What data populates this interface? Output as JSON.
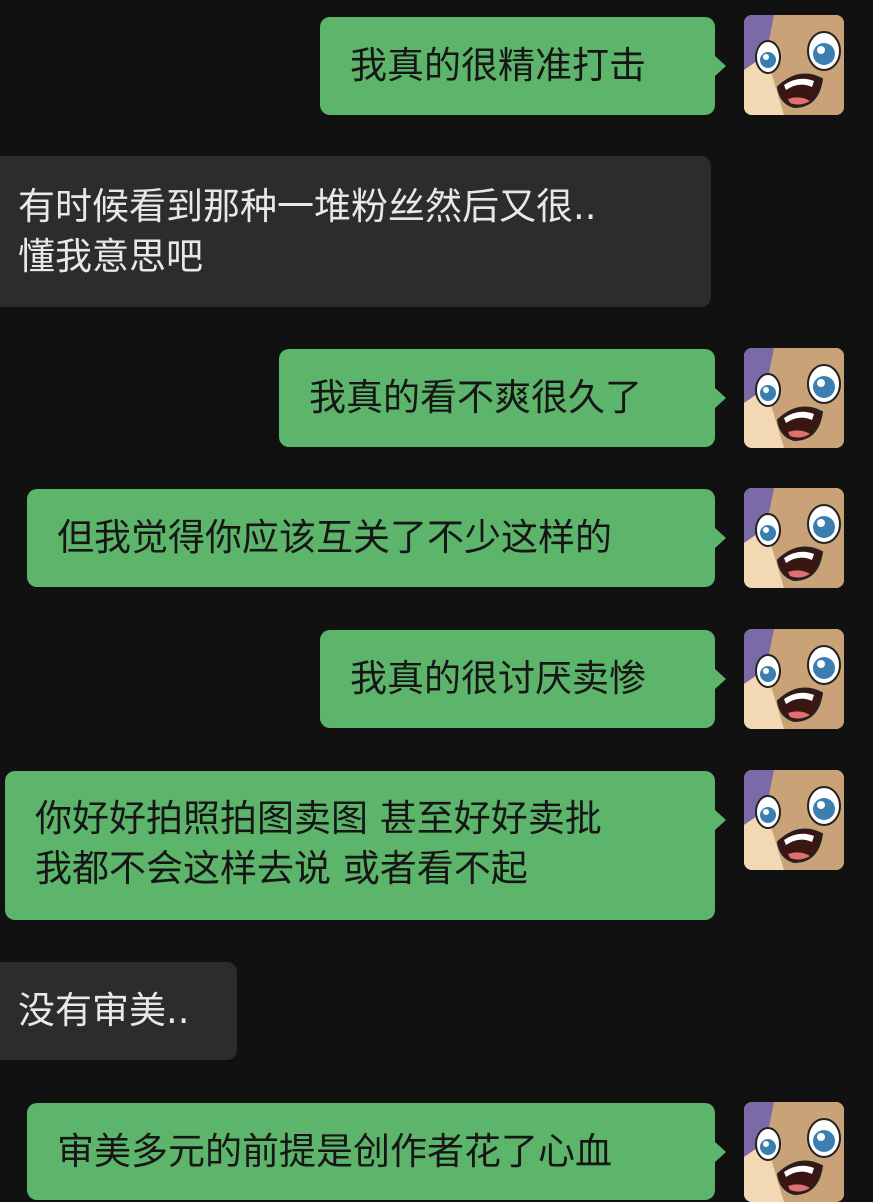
{
  "messages": [
    {
      "side": "out",
      "lines": [
        "我真的很精准打击"
      ]
    },
    {
      "side": "in",
      "lines": [
        "有时候看到那种一堆粉丝然后又很..",
        "懂我意思吧"
      ]
    },
    {
      "side": "out",
      "lines": [
        "我真的看不爽很久了"
      ]
    },
    {
      "side": "out",
      "lines": [
        "但我觉得你应该互关了不少这样的"
      ]
    },
    {
      "side": "out",
      "lines": [
        "我真的很讨厌卖惨"
      ]
    },
    {
      "side": "out",
      "lines": [
        "你好好拍照拍图卖图 甚至好好卖批",
        "我都不会这样去说 或者看不起"
      ]
    },
    {
      "side": "in",
      "lines": [
        "没有审美.."
      ]
    },
    {
      "side": "out",
      "lines": [
        "审美多元的前提是创作者花了心血"
      ]
    }
  ],
  "avatar": {
    "icon": "cartoon-face-icon"
  },
  "colors": {
    "background": "#111111",
    "outgoing": "#5cb56a",
    "incoming": "#2c2c2c"
  }
}
